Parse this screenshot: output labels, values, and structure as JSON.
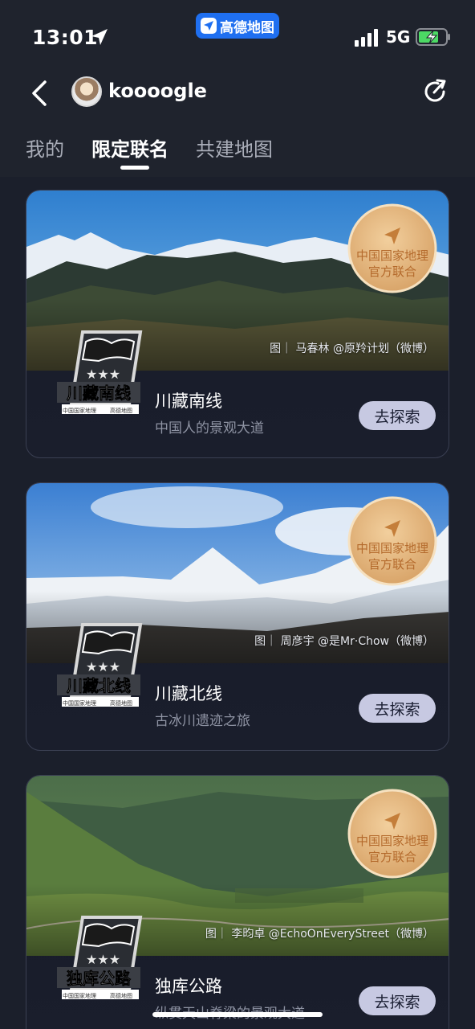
{
  "status_bar": {
    "time": "13:01",
    "app_name": "高德地图",
    "network": "5G",
    "battery_charging": true
  },
  "header": {
    "username": "koooogle",
    "back_icon": "chevron-left-icon",
    "share_icon": "share-refresh-icon"
  },
  "tabs": [
    {
      "label": "我的",
      "active": false
    },
    {
      "label": "限定联名",
      "active": true
    },
    {
      "label": "共建地图",
      "active": false
    }
  ],
  "seal": {
    "line1": "中国国家地理",
    "line2": "官方联合"
  },
  "badge_footer": {
    "left": "中国国家地理",
    "right": "高德地图"
  },
  "cards": [
    {
      "title": "川藏南线",
      "subtitle": "中国人的景观大道",
      "credit": "图｜ 马春林 @原羚计划（微博）",
      "badge_text": "川藏南线",
      "button": "去探索"
    },
    {
      "title": "川藏北线",
      "subtitle": "古冰川遗迹之旅",
      "credit": "图｜ 周彦宇 @是Mr·Chow（微博）",
      "badge_text": "川藏北线",
      "button": "去探索"
    },
    {
      "title": "独库公路",
      "subtitle": "纵贯天山脊梁的景观大道",
      "credit": "图｜ 李昀卓 @EchoOnEveryStreet（微博）",
      "badge_text": "独库公路",
      "button": "去探索"
    }
  ],
  "colors": {
    "background": "#1b1f2b",
    "button_bg": "#c7c9e2",
    "seal_gold": "#e0b47e"
  }
}
